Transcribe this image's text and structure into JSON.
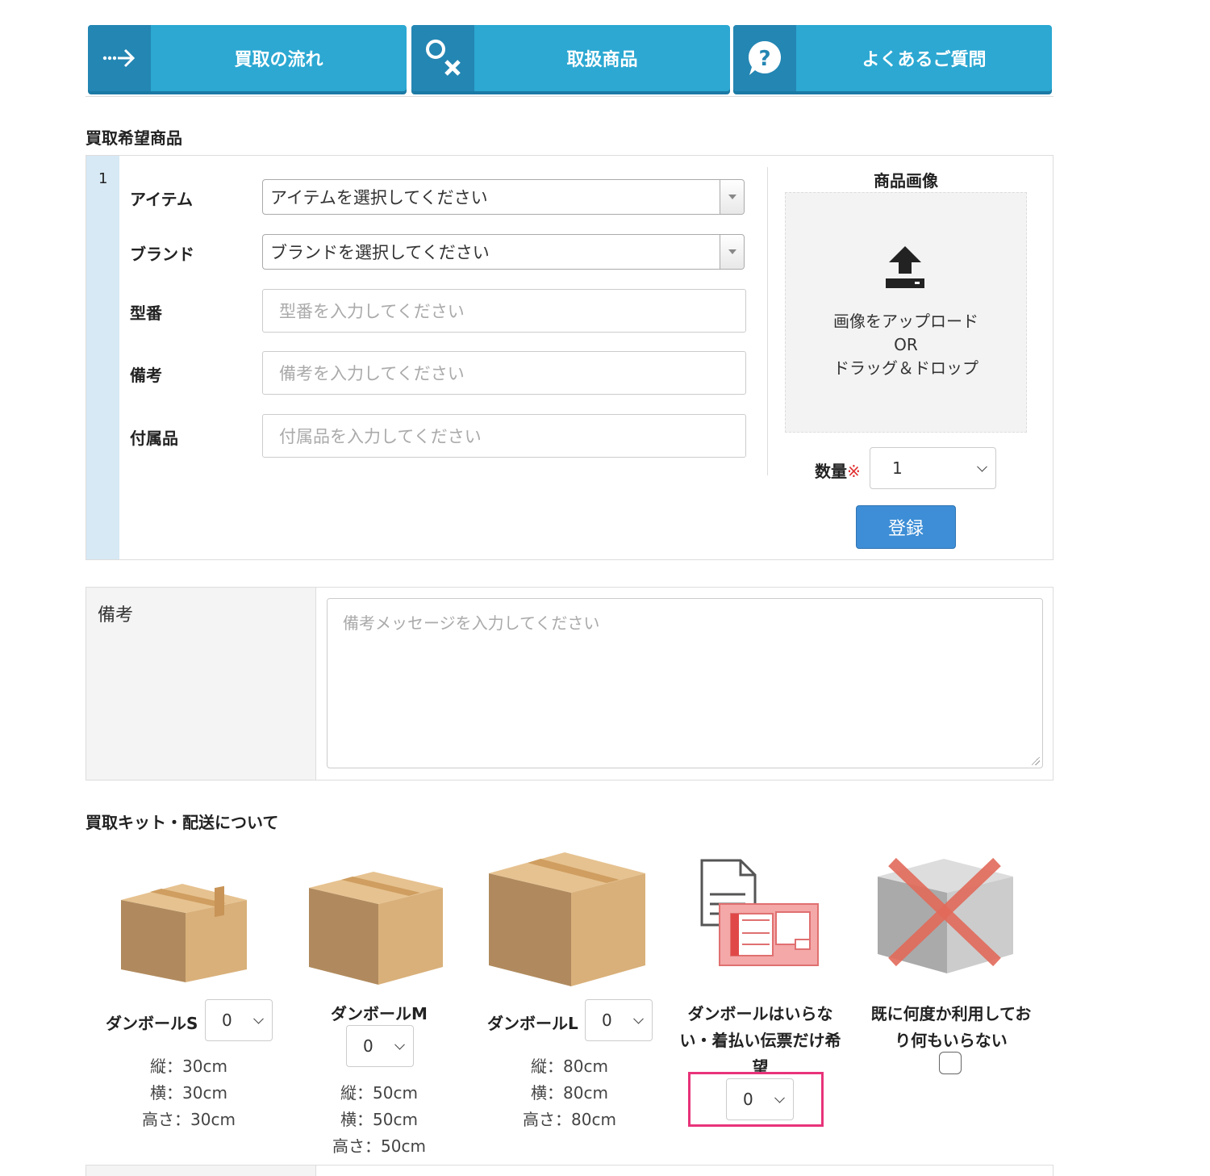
{
  "nav": {
    "flow_label": "買取の流れ",
    "items_label": "取扱商品",
    "faq_label": "よくあるご質問"
  },
  "item_section": {
    "title": "買取希望商品",
    "row_number": "1",
    "item_label": "アイテム",
    "item_select": "アイテムを選択してください",
    "brand_label": "ブランド",
    "brand_select": "ブランドを選択してください",
    "model_label": "型番",
    "model_placeholder": "型番を入力してください",
    "note_label": "備考",
    "note_placeholder": "備考を入力してください",
    "accessory_label": "付属品",
    "accessory_placeholder": "付属品を入力してください",
    "image_title": "商品画像",
    "upload_line1": "画像をアップロード",
    "upload_line2": "OR",
    "upload_line3": "ドラッグ＆ドロップ",
    "qty_label": "数量",
    "qty_required_mark": "※",
    "qty_value": "1",
    "register_button": "登録"
  },
  "remarks": {
    "label": "備考",
    "placeholder": "備考メッセージを入力してください"
  },
  "kit_section": {
    "title": "買取キット・配送について",
    "box_s": {
      "label": "ダンボールS",
      "qty": "0",
      "d1": "縦：30cm",
      "d2": "横：30cm",
      "d3": "高さ：30cm"
    },
    "box_m": {
      "label": "ダンボールM",
      "qty": "0",
      "d1": "縦：50cm",
      "d2": "横：50cm",
      "d3": "高さ：50cm"
    },
    "box_l": {
      "label": "ダンボールL",
      "qty": "0",
      "d1": "縦：80cm",
      "d2": "横：80cm",
      "d3": "高さ：80cm"
    },
    "slip_only": {
      "line1": "ダンボールはいらな",
      "line2": "い・着払い伝票だけ希",
      "line3": "望",
      "qty": "0"
    },
    "nothing": {
      "line1": "既に何度か利用してお",
      "line2": "り何もいらない"
    }
  },
  "colors": {
    "nav_blue": "#2ca8d2",
    "register_blue": "#3d8ed6",
    "highlight_pink": "#e8337a",
    "required_red": "#e03030"
  }
}
